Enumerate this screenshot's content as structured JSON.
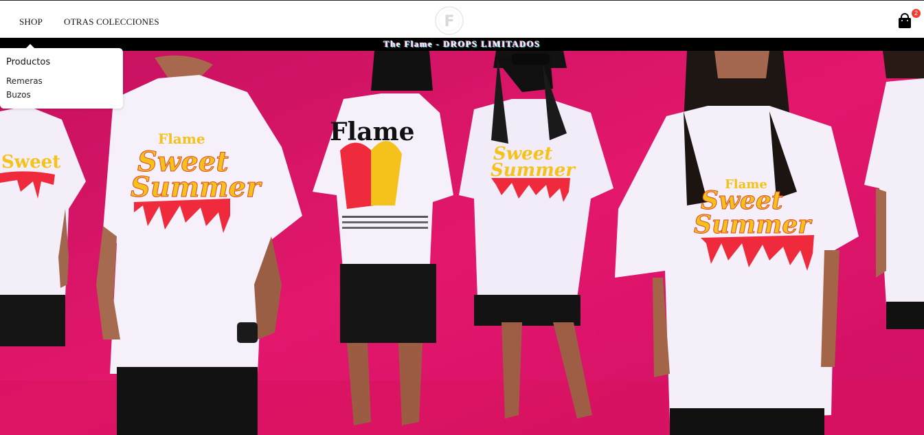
{
  "header": {
    "nav": [
      {
        "label": "SHOP"
      },
      {
        "label": "OTRAS COLECCIONES"
      }
    ],
    "logo": {
      "icon": "flame-f-logo-icon",
      "letter": "F"
    },
    "cart": {
      "icon": "shopping-bag-icon",
      "count": "2"
    }
  },
  "announcement": {
    "text": "The Flame - DROPS LIMITADOS"
  },
  "dropdown": {
    "title": "Productos",
    "items": [
      {
        "label": "Remeras"
      },
      {
        "label": "Buzos"
      }
    ]
  },
  "hero": {
    "image": "models-wearing-sweet-summer-tshirts",
    "shirt_print": {
      "brand": "Flame",
      "line1": "Sweet",
      "line2": "Summer"
    },
    "back_print": "Flame",
    "colors": {
      "background": "#e0156a",
      "shirt": "#f3eef8",
      "shorts": "#141414",
      "print_yellow": "#f4c21a",
      "print_red": "#ee2a3c"
    }
  }
}
